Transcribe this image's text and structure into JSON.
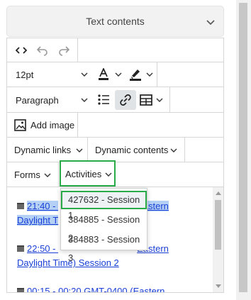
{
  "panel": {
    "title": "Text contents"
  },
  "toolbar": {
    "font_size": "12pt",
    "block_format": "Paragraph",
    "add_image_label": "Add image",
    "dynamic_links_label": "Dynamic links",
    "dynamic_contents_label": "Dynamic contents",
    "forms_label": "Forms",
    "activities_label": "Activities"
  },
  "activities_menu": {
    "items": [
      {
        "label": "427632 - Session 1",
        "active": true
      },
      {
        "label": "384885 - Session 2",
        "active": false
      },
      {
        "label": "384883 - Session 3",
        "active": false
      }
    ]
  },
  "content": {
    "entries": [
      {
        "line1": "21:40 - ",
        "line1_tail": "Eastern",
        "line2": "Daylight T"
      },
      {
        "line1": "22:50 - ",
        "line1_tail": "Eastern",
        "line2": "Daylight Time) Session 2"
      },
      {
        "line1": "00:15 - 00:20 GMT-0400 (Eastern"
      }
    ]
  },
  "colors": {
    "highlight": "#2bab48",
    "link": "#1a3fd6",
    "selection": "#b4d0f5"
  }
}
